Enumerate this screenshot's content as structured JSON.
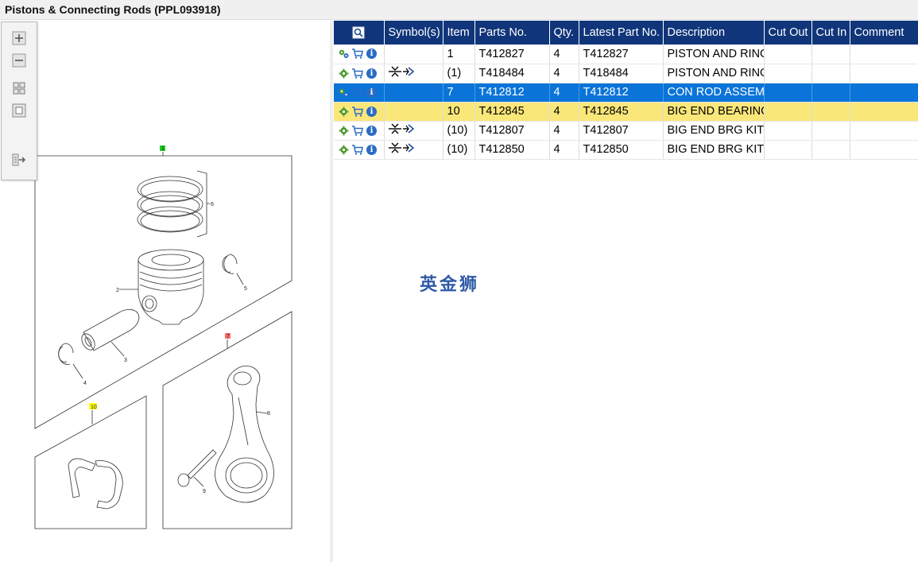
{
  "window": {
    "title": "Pistons & Connecting Rods (PPL093918)"
  },
  "toolbar": {
    "buttons": [
      {
        "name": "zoom-in",
        "icon": "zoom-in-icon"
      },
      {
        "name": "zoom-out",
        "icon": "zoom-out-icon"
      },
      {
        "name": "fit-all",
        "icon": "fit-all-icon"
      },
      {
        "name": "actual-size",
        "icon": "actual-size-icon"
      },
      {
        "name": "expand-list",
        "icon": "expand-list-icon"
      }
    ]
  },
  "diagram": {
    "callouts": {
      "c1": "1",
      "c2": "2",
      "c3": "3",
      "c4": "4",
      "c5": "5",
      "c6": "6",
      "c7": "7",
      "c8": "8",
      "c9": "9",
      "c10": "10"
    },
    "tag_colors": {
      "group1": "#22cc22",
      "group7": "#ff6b6b",
      "group10": "#ffff00"
    }
  },
  "table": {
    "columns": [
      "Symbol(s)",
      "Item",
      "Parts No.",
      "Qty.",
      "Latest Part No.",
      "Description",
      "Cut Out",
      "Cut In",
      "Comment"
    ],
    "rows": [
      {
        "item": "1",
        "part_no": "T412827",
        "qty": "4",
        "latest": "T412827",
        "desc": "PISTON AND RING",
        "symbol": false,
        "icon": "gears",
        "state": ""
      },
      {
        "item": "(1)",
        "part_no": "T418484",
        "qty": "4",
        "latest": "T418484",
        "desc": "PISTON AND RING",
        "symbol": true,
        "icon": "gear",
        "state": ""
      },
      {
        "item": "7",
        "part_no": "T412812",
        "qty": "4",
        "latest": "T412812",
        "desc": "CON ROD ASSEMB",
        "symbol": false,
        "icon": "gears",
        "state": "sel"
      },
      {
        "item": "10",
        "part_no": "T412845",
        "qty": "4",
        "latest": "T412845",
        "desc": "BIG END BEARING",
        "symbol": false,
        "icon": "gear",
        "state": "hl"
      },
      {
        "item": "(10)",
        "part_no": "T412807",
        "qty": "4",
        "latest": "T412807",
        "desc": "BIG END BRG KIT -",
        "symbol": true,
        "icon": "gear",
        "state": ""
      },
      {
        "item": "(10)",
        "part_no": "T412850",
        "qty": "4",
        "latest": "T412850",
        "desc": "BIG END BRG KIT -",
        "symbol": true,
        "icon": "gear",
        "state": ""
      }
    ]
  },
  "watermark": "英金狮",
  "colors": {
    "header": "#10357a",
    "selected": "#0a74d8",
    "highlight": "#fae77a"
  }
}
